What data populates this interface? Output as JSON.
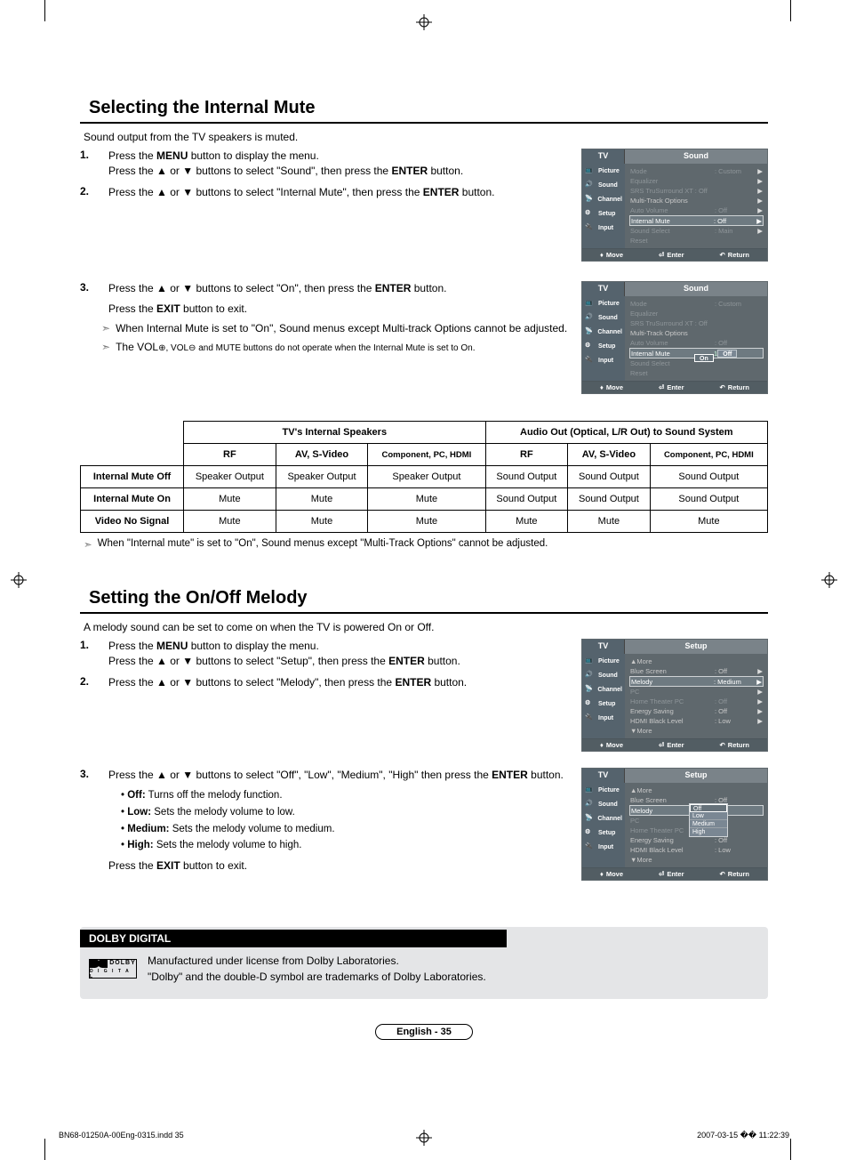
{
  "section1": {
    "title": "Selecting the Internal Mute",
    "intro": "Sound output from the TV speakers is muted.",
    "steps12": {
      "s1_a": "Press the ",
      "s1_menu": "MENU",
      "s1_b": " button to display the menu.",
      "s1_c": "Press the ▲ or ▼ buttons to select \"Sound\", then press the ",
      "s1_enter": "ENTER",
      "s1_d": " button.",
      "s2_a": "Press the ▲ or ▼ buttons to select \"Internal Mute\", then press the ",
      "s2_enter": "ENTER",
      "s2_b": " button."
    },
    "steps3": {
      "s3_a": "Press the ▲ or ▼ buttons to select \"On\", then press the ",
      "s3_enter": "ENTER",
      "s3_b": " button.",
      "s3_c": "Press the ",
      "s3_exit": "EXIT",
      "s3_d": " button to exit.",
      "n1": "When Internal Mute is set to \"On\", Sound menus except Multi-track Options cannot be adjusted.",
      "n2_a": "The VOL",
      "n2_plus": "⊕, VOL",
      "n2_minus": "⊖  and MUTE buttons do not operate when the Internal Mute is set to On."
    }
  },
  "osd_sound1": {
    "tv": "TV",
    "title": "Sound",
    "tabs": [
      "Picture",
      "Sound",
      "Channel",
      "Setup",
      "Input"
    ],
    "rows": [
      {
        "label": "Mode",
        "val": ": Custom",
        "dim": true,
        "arrow": true
      },
      {
        "label": "Equalizer",
        "val": "",
        "dim": true,
        "arrow": true
      },
      {
        "label": "SRS TruSurround XT : Off",
        "val": "",
        "dim": true,
        "arrow": true
      },
      {
        "label": "Multi-Track Options",
        "val": "",
        "dim": false,
        "arrow": true
      },
      {
        "label": "Auto Volume",
        "val": ": Off",
        "dim": true,
        "arrow": true
      },
      {
        "label": "Internal Mute",
        "val": ": Off",
        "hl": true,
        "arrow": true
      },
      {
        "label": "Sound Select",
        "val": ": Main",
        "dim": true,
        "arrow": true
      },
      {
        "label": "Reset",
        "val": "",
        "dim": true
      }
    ],
    "foot": {
      "move": "Move",
      "enter": "Enter",
      "return": "Return"
    }
  },
  "osd_sound2": {
    "tv": "TV",
    "title": "Sound",
    "tabs": [
      "Picture",
      "Sound",
      "Channel",
      "Setup",
      "Input"
    ],
    "rows": [
      {
        "label": "Mode",
        "val": ": Custom",
        "dim": true
      },
      {
        "label": "Equalizer",
        "val": "",
        "dim": true
      },
      {
        "label": "SRS TruSurround XT : Off",
        "val": "",
        "dim": true
      },
      {
        "label": "Multi-Track Options",
        "val": "",
        "dim": false
      },
      {
        "label": "Auto Volume",
        "val": ": Off",
        "dim": true
      },
      {
        "label": "Internal Mute",
        "val": ":",
        "hl": true,
        "pillnum": "1",
        "pill": "Off"
      },
      {
        "label": "",
        "val": "",
        "extra_pill": "On",
        "extra_sel": true
      },
      {
        "label": "Sound Select",
        "val": "",
        "dim": true
      },
      {
        "label": "Reset",
        "val": "",
        "dim": true
      }
    ],
    "foot": {
      "move": "Move",
      "enter": "Enter",
      "return": "Return"
    }
  },
  "table": {
    "h_int": "TV's Internal Speakers",
    "h_out": "Audio Out (Optical, L/R Out) to Sound System",
    "cols": [
      "RF",
      "AV, S-Video",
      "Component, PC, HDMI",
      "RF",
      "AV, S-Video",
      "Component, PC, HDMI"
    ],
    "rows": [
      {
        "head": "Internal Mute Off",
        "cells": [
          "Speaker Output",
          "Speaker Output",
          "Speaker Output",
          "Sound Output",
          "Sound Output",
          "Sound Output"
        ]
      },
      {
        "head": "Internal Mute On",
        "cells": [
          "Mute",
          "Mute",
          "Mute",
          "Sound Output",
          "Sound Output",
          "Sound Output"
        ]
      },
      {
        "head": "Video No Signal",
        "cells": [
          "Mute",
          "Mute",
          "Mute",
          "Mute",
          "Mute",
          "Mute"
        ]
      }
    ],
    "note": "When \"Internal mute\" is set to \"On\", Sound menus except \"Multi-Track Options\" cannot be adjusted."
  },
  "section2": {
    "title": "Setting the On/Off Melody",
    "intro": "A melody sound can be set to come on when the TV is powered On or Off.",
    "steps12": {
      "s1_a": "Press the ",
      "s1_menu": "MENU",
      "s1_b": " button to display the menu.",
      "s1_c": "Press the ▲ or ▼ buttons to select \"Setup\", then press the ",
      "s1_enter": "ENTER",
      "s1_d": " button.",
      "s2_a": "Press the ▲ or ▼ buttons to select \"Melody\", then press the ",
      "s2_enter": "ENTER",
      "s2_b": " button."
    },
    "steps3": {
      "s3_a": "Press the ▲ or ▼ buttons to select \"Off\", \"Low\", \"Medium\", \"High\" then press the ",
      "s3_enter": "ENTER",
      "s3_b": " button.",
      "opts": [
        {
          "b": "Off:",
          "t": " Turns off the melody function."
        },
        {
          "b": "Low:",
          "t": " Sets the melody volume to low."
        },
        {
          "b": "Medium:",
          "t": " Sets the melody volume to medium."
        },
        {
          "b": "High:",
          "t": " Sets the melody volume to high."
        }
      ],
      "exit_a": "Press the ",
      "exit_b": "EXIT",
      "exit_c": " button to exit."
    }
  },
  "osd_setup1": {
    "tv": "TV",
    "title": "Setup",
    "tabs": [
      "Picture",
      "Sound",
      "Channel",
      "Setup",
      "Input"
    ],
    "rows": [
      {
        "label": "▲More",
        "val": ""
      },
      {
        "label": "Blue Screen",
        "val": ": Off",
        "arrow": true
      },
      {
        "label": "Melody",
        "val": ": Medium",
        "hl": true,
        "arrow": true
      },
      {
        "label": "PC",
        "val": "",
        "dim": true,
        "arrow": true
      },
      {
        "label": "Home Theater PC",
        "val": ": Off",
        "dim": true,
        "arrow": true
      },
      {
        "label": "Energy Saving",
        "val": ": Off",
        "arrow": true
      },
      {
        "label": "HDMI Black Level",
        "val": ": Low",
        "arrow": true
      },
      {
        "label": "▼More",
        "val": ""
      }
    ],
    "foot": {
      "move": "Move",
      "enter": "Enter",
      "return": "Return"
    }
  },
  "osd_setup2": {
    "tv": "TV",
    "title": "Setup",
    "tabs": [
      "Picture",
      "Sound",
      "Channel",
      "Setup",
      "Input"
    ],
    "rows": [
      {
        "label": "▲More",
        "val": ""
      },
      {
        "label": "Blue Screen",
        "val": ": Off"
      },
      {
        "label": "Melody",
        "val": ":",
        "hl": true
      },
      {
        "label": "PC",
        "val": "",
        "dim": true
      },
      {
        "label": "Home Theater PC",
        "val": "",
        "dim": true
      },
      {
        "label": "Energy Saving",
        "val": ": Off"
      },
      {
        "label": "HDMI Black Level",
        "val": ": Low"
      },
      {
        "label": "▼More",
        "val": ""
      }
    ],
    "dd": [
      "Off",
      "Low",
      "Medium",
      "High"
    ],
    "dd_sel": 0,
    "foot": {
      "move": "Move",
      "enter": "Enter",
      "return": "Return"
    }
  },
  "dolby": {
    "tab": "DOLBY DIGITAL",
    "logo_top": "DOLBY",
    "logo_sub": "D I G I T A L",
    "l1": "Manufactured under license from Dolby Laboratories.",
    "l2": "\"Dolby\" and the double-D symbol are trademarks of Dolby Laboratories."
  },
  "page_footer": "English - 35",
  "print_footer": {
    "file": "BN68-01250A-00Eng-0315.indd   35",
    "stamp": "2007-03-15   �� 11:22:39"
  }
}
